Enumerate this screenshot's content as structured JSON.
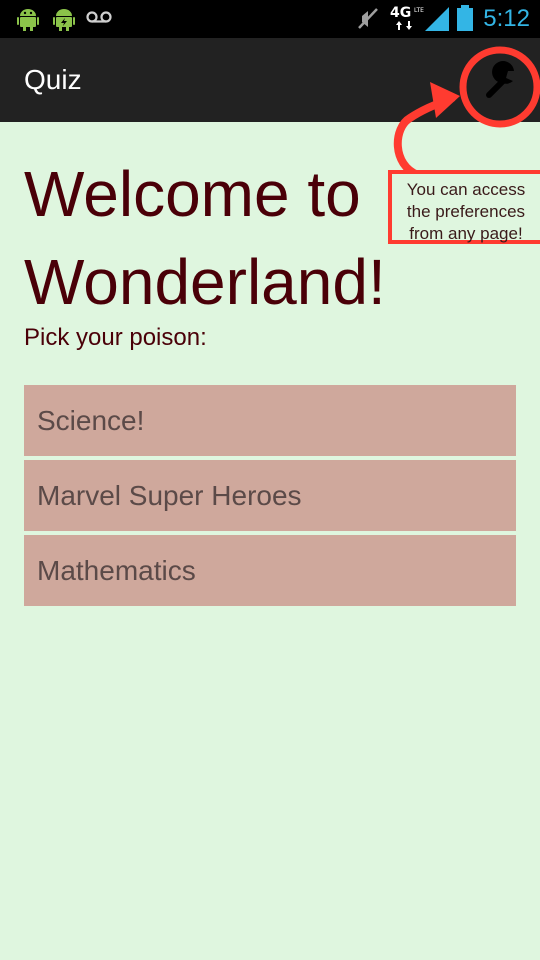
{
  "status_bar": {
    "time": "5:12",
    "icons": [
      "android-icon",
      "android-battery-icon",
      "voicemail-icon",
      "mute-icon",
      "4g-lte-icon",
      "signal-icon",
      "battery-icon"
    ],
    "colors": {
      "background": "#000000",
      "time": "#33b5e5"
    }
  },
  "action_bar": {
    "title": "Quiz",
    "settings_icon": "wrench-icon"
  },
  "main": {
    "title": "Welcome to Wonderland!",
    "subtitle": "Pick your poison:",
    "topics": [
      {
        "label": "Science!"
      },
      {
        "label": "Marvel Super Heroes"
      },
      {
        "label": "Mathematics"
      }
    ]
  },
  "annotation": {
    "lines": [
      "You can access",
      "the preferences",
      "from any page!"
    ],
    "color": "#ff3b30"
  },
  "colors": {
    "page_background": "#dff6df",
    "action_bar": "#222222",
    "title_text": "#4a0008",
    "topic_background": "#cfa89c",
    "topic_text": "#5b4a48"
  }
}
